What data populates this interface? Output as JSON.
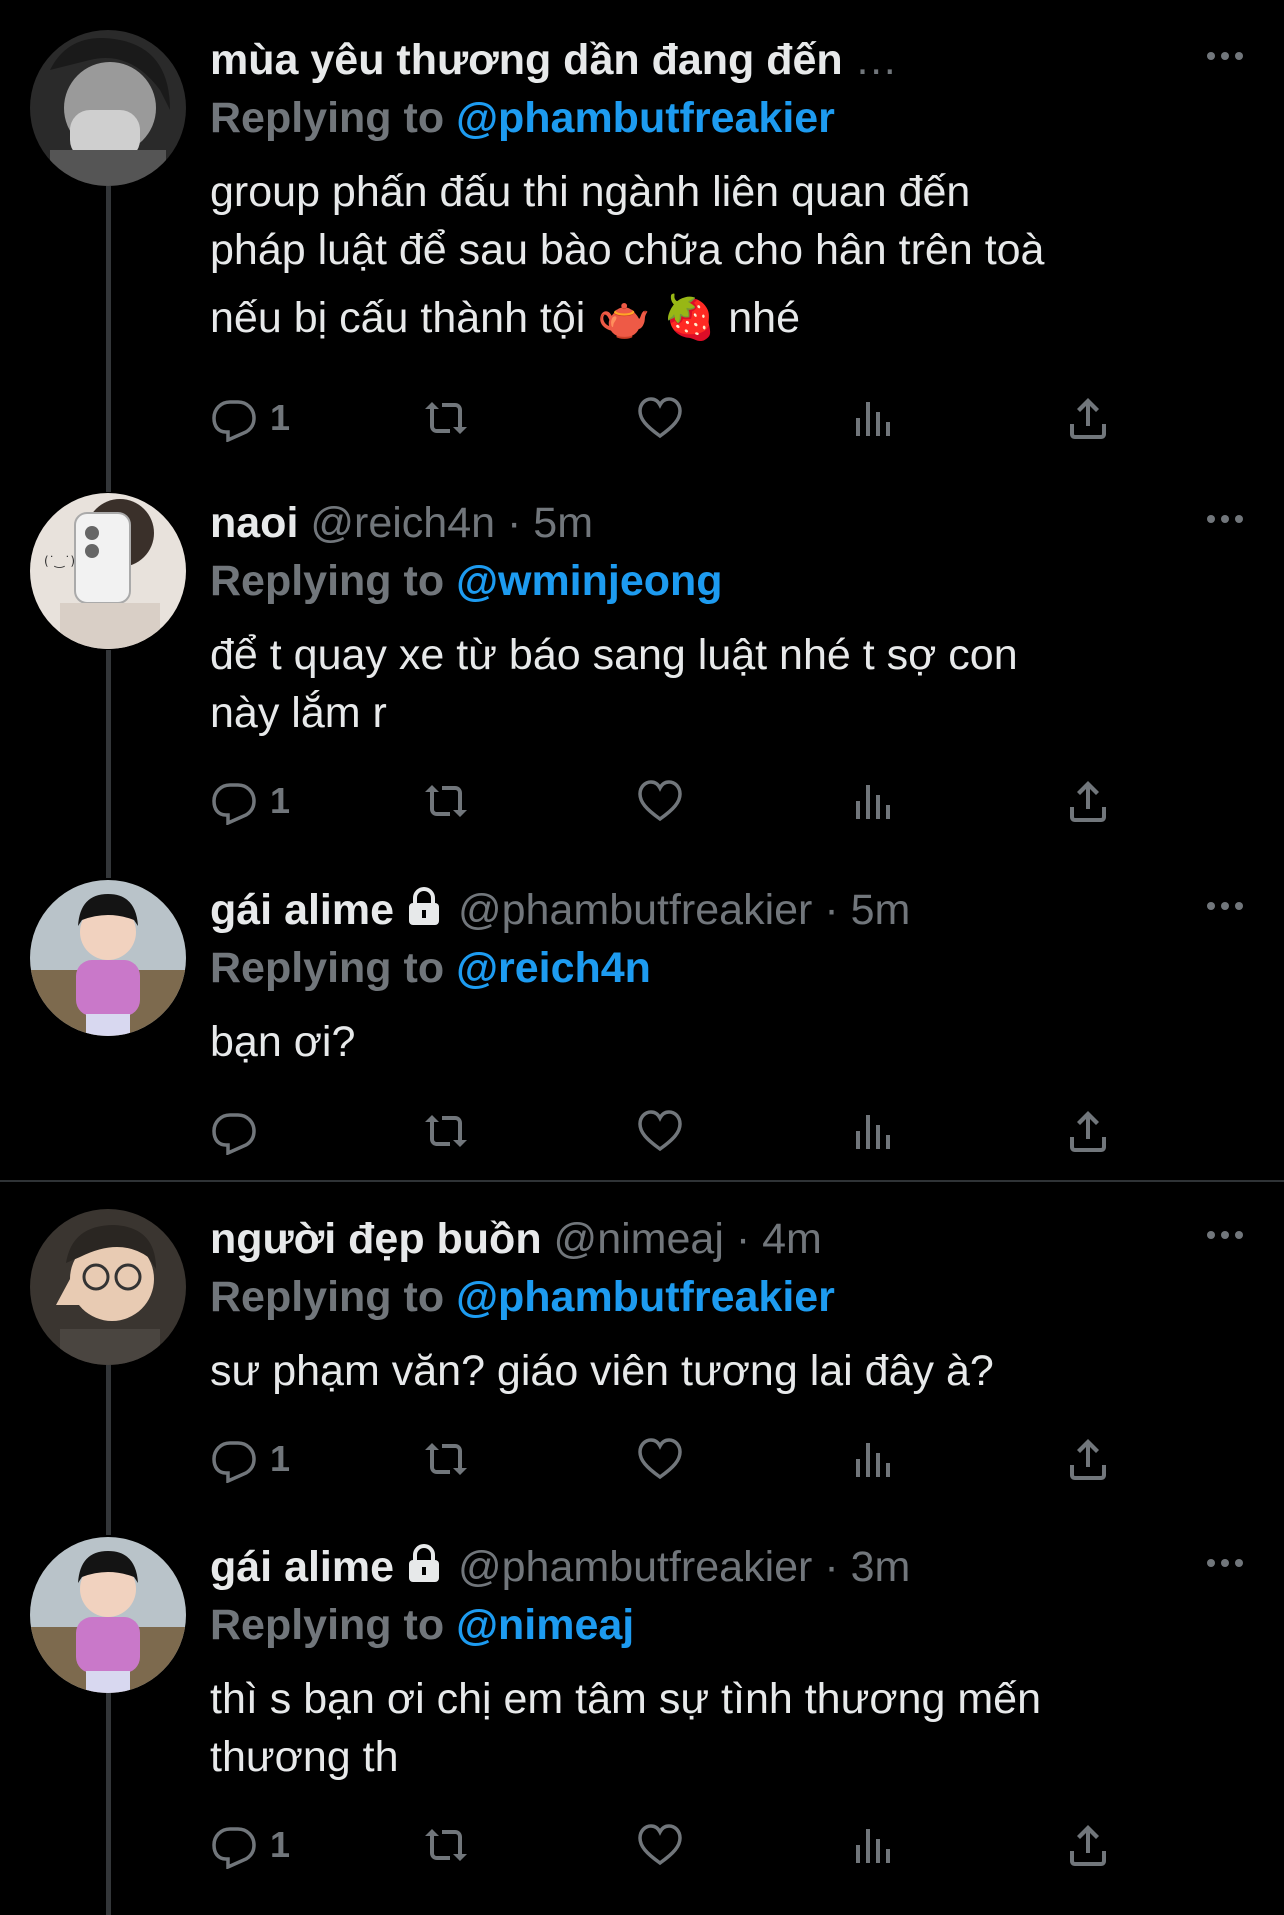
{
  "tweets": [
    {
      "name": "mùa yêu thương dần đang đến",
      "truncated": "…",
      "handle": "",
      "time": "",
      "dot": "",
      "locked": false,
      "reply_prefix": "Replying to",
      "reply_to": "@phambutfreakier",
      "lines": [
        "group phấn đấu thi ngành liên quan đến",
        "pháp luật để sau bào chữa cho hân trên toà",
        "nếu bị cấu thành tội 🫖 🍓  nhé"
      ],
      "reply_count": "1"
    },
    {
      "name": "naoi",
      "truncated": "",
      "handle": "@reich4n",
      "dot": "·",
      "time": "5m",
      "locked": false,
      "reply_prefix": "Replying to",
      "reply_to": "@wminjeong",
      "lines": [
        "để t quay xe từ báo sang luật nhé t sợ con",
        "này lắm r"
      ],
      "reply_count": "1"
    },
    {
      "name": "gái alime",
      "truncated": "",
      "handle": "@phambutfreakier",
      "dot": "·",
      "time": "5m",
      "locked": true,
      "reply_prefix": "Replying to",
      "reply_to": "@reich4n",
      "lines": [
        "bạn ơi?"
      ],
      "reply_count": ""
    },
    {
      "name": "người đẹp buồn",
      "truncated": "",
      "handle": "@nimeaj",
      "dot": "·",
      "time": "4m",
      "locked": false,
      "reply_prefix": "Replying to",
      "reply_to": "@phambutfreakier",
      "lines": [
        "sư phạm văn? giáo viên tương lai đây à?"
      ],
      "reply_count": "1"
    },
    {
      "name": "gái alime",
      "truncated": "",
      "handle": "@phambutfreakier",
      "dot": "·",
      "time": "3m",
      "locked": true,
      "reply_prefix": "Replying to",
      "reply_to": "@nimeaj",
      "lines": [
        "thì s bạn ơi chị em tâm sự tình thương mến",
        "thương th"
      ],
      "reply_count": "1"
    }
  ],
  "icons": {
    "reply": "reply-icon",
    "retweet": "retweet-icon",
    "like": "heart-icon",
    "views": "views-icon",
    "share": "share-icon",
    "more": "more-icon",
    "lock": "lock-icon"
  },
  "colors": {
    "background": "#000000",
    "text": "#e7e9ea",
    "secondary": "#71767b",
    "link": "#1d9bf0",
    "divider": "#2f3336"
  }
}
